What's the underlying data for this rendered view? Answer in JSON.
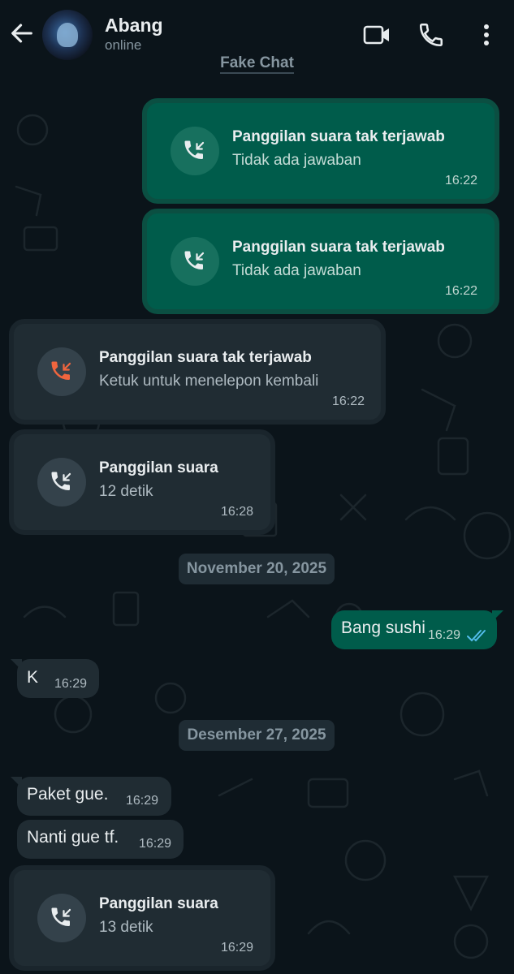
{
  "header": {
    "contact_name": "Abang",
    "contact_status": "online",
    "watermark": "Fake Chat"
  },
  "colors": {
    "background": "#0b141a",
    "outgoing_bubble": "#005c4b",
    "incoming_bubble": "#202c33",
    "missed_call_icon": "#f0653e",
    "read_ticks": "#53bdeb"
  },
  "messages": [
    {
      "type": "call",
      "direction": "outgoing",
      "title": "Panggilan suara tak terjawab",
      "subtitle": "Tidak ada jawaban",
      "time": "16:22"
    },
    {
      "type": "call",
      "direction": "outgoing",
      "title": "Panggilan suara tak terjawab",
      "subtitle": "Tidak ada jawaban",
      "time": "16:22"
    },
    {
      "type": "call",
      "direction": "incoming",
      "missed": true,
      "title": "Panggilan suara tak terjawab",
      "subtitle": "Ketuk untuk menelepon kembali",
      "time": "16:22"
    },
    {
      "type": "call",
      "direction": "incoming",
      "title": "Panggilan suara",
      "subtitle": "12 detik",
      "time": "16:28"
    },
    {
      "type": "date",
      "label": "November 20, 2025"
    },
    {
      "type": "text",
      "direction": "outgoing",
      "text": "Bang sushi",
      "time": "16:29",
      "status": "read"
    },
    {
      "type": "text",
      "direction": "incoming",
      "text": "K",
      "time": "16:29"
    },
    {
      "type": "date",
      "label": "Desember 27, 2025"
    },
    {
      "type": "text",
      "direction": "incoming",
      "text": "Paket gue.",
      "time": "16:29"
    },
    {
      "type": "text",
      "direction": "incoming",
      "text": "Nanti gue tf.",
      "time": "16:29"
    },
    {
      "type": "call",
      "direction": "incoming",
      "title": "Panggilan suara",
      "subtitle": "13 detik",
      "time": "16:29"
    }
  ],
  "icons": {
    "back": "arrow-left-icon",
    "video": "video-camera-icon",
    "voice": "phone-icon",
    "menu": "more-vertical-icon",
    "call": "incoming-call-icon",
    "missed_call": "missed-call-icon",
    "read": "double-check-icon"
  }
}
